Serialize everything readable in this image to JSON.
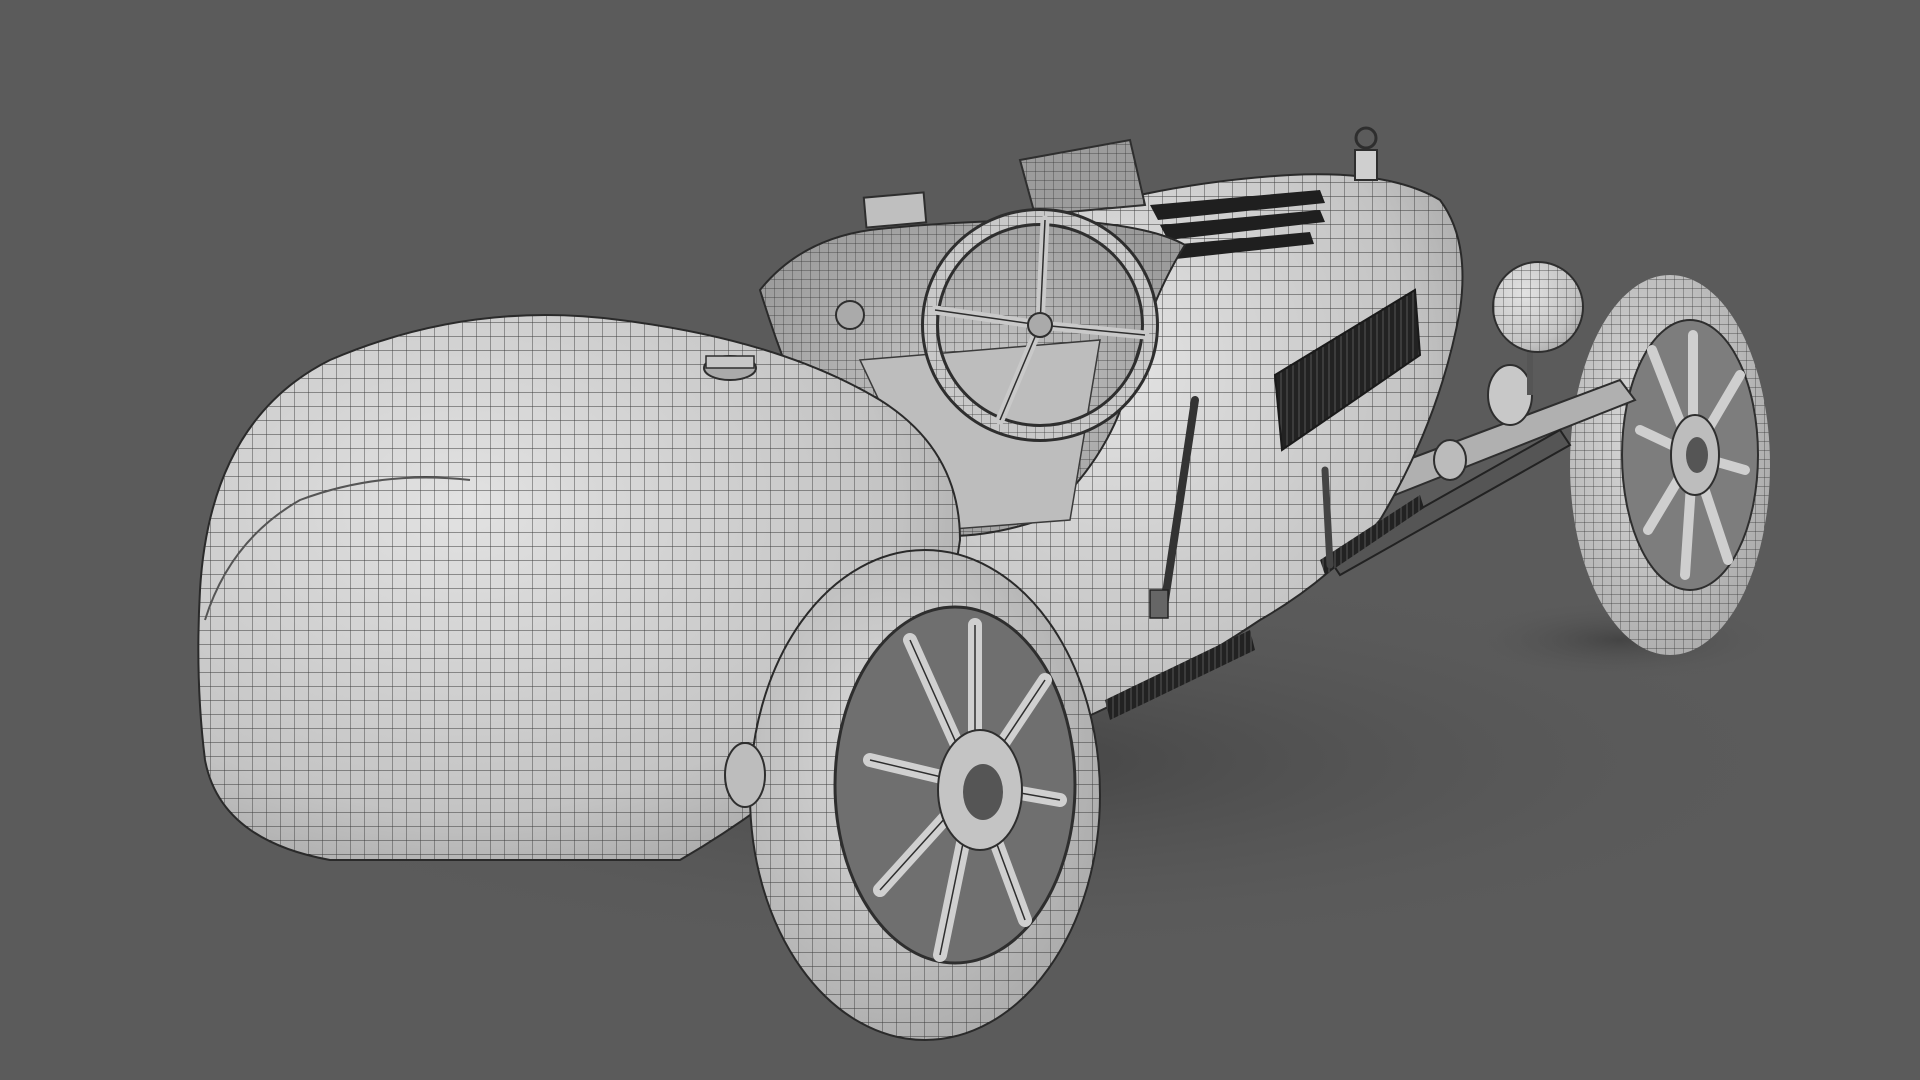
{
  "scene": {
    "background_color": "#5a5a5a",
    "floor_shadow_color": "#474747",
    "subject": "vintage-race-car-wireframe-render",
    "body_fill": "#d4d4d4",
    "body_shade": "#a9a9a9",
    "wire_color": "#2e2e2e",
    "dark_detail": "#1f1f1f"
  }
}
